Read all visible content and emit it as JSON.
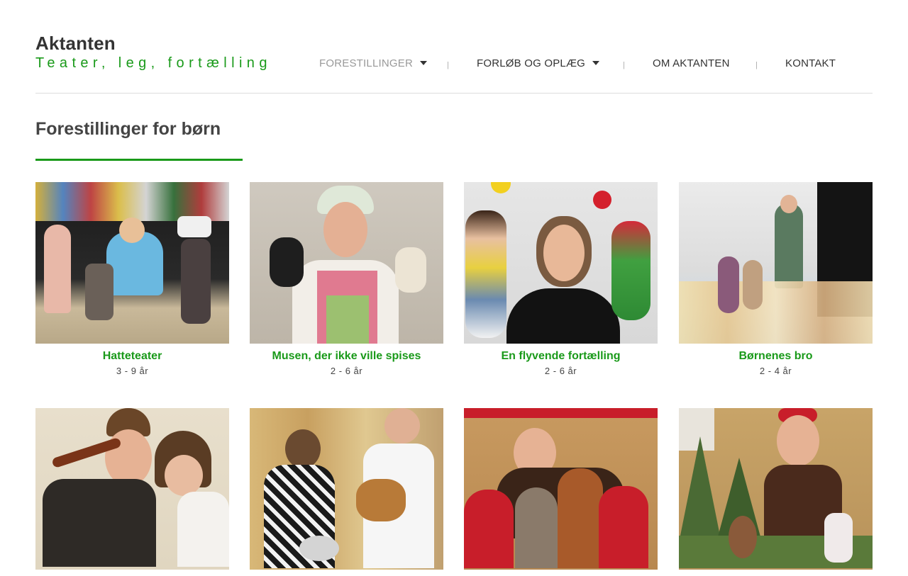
{
  "site": {
    "title": "Aktanten",
    "tagline": "Teater, leg, fortælling"
  },
  "nav": {
    "items": [
      {
        "label": "FORESTILLINGER",
        "has_dropdown": true,
        "active": true
      },
      {
        "label": "FORLØB OG OPLÆG",
        "has_dropdown": true,
        "active": false
      },
      {
        "label": "OM AKTANTEN",
        "has_dropdown": false,
        "active": false
      },
      {
        "label": "KONTAKT",
        "has_dropdown": false,
        "active": false
      }
    ],
    "separator": "|"
  },
  "page": {
    "heading": "Forestillinger for børn"
  },
  "cards": [
    {
      "title": "Hatteteater",
      "age": "3 - 9 år"
    },
    {
      "title": "Musen, der ikke ville spises",
      "age": "2 - 6 år"
    },
    {
      "title": "En flyvende fortælling",
      "age": "2 - 6 år"
    },
    {
      "title": "Børnenes bro",
      "age": "2 - 4 år"
    },
    {
      "title": "",
      "age": ""
    },
    {
      "title": "",
      "age": ""
    },
    {
      "title": "",
      "age": ""
    },
    {
      "title": "",
      "age": ""
    }
  ],
  "colors": {
    "accent": "#1a9a1a",
    "text": "#333333",
    "nav_active": "#999999",
    "divider": "#dcdcdc"
  }
}
